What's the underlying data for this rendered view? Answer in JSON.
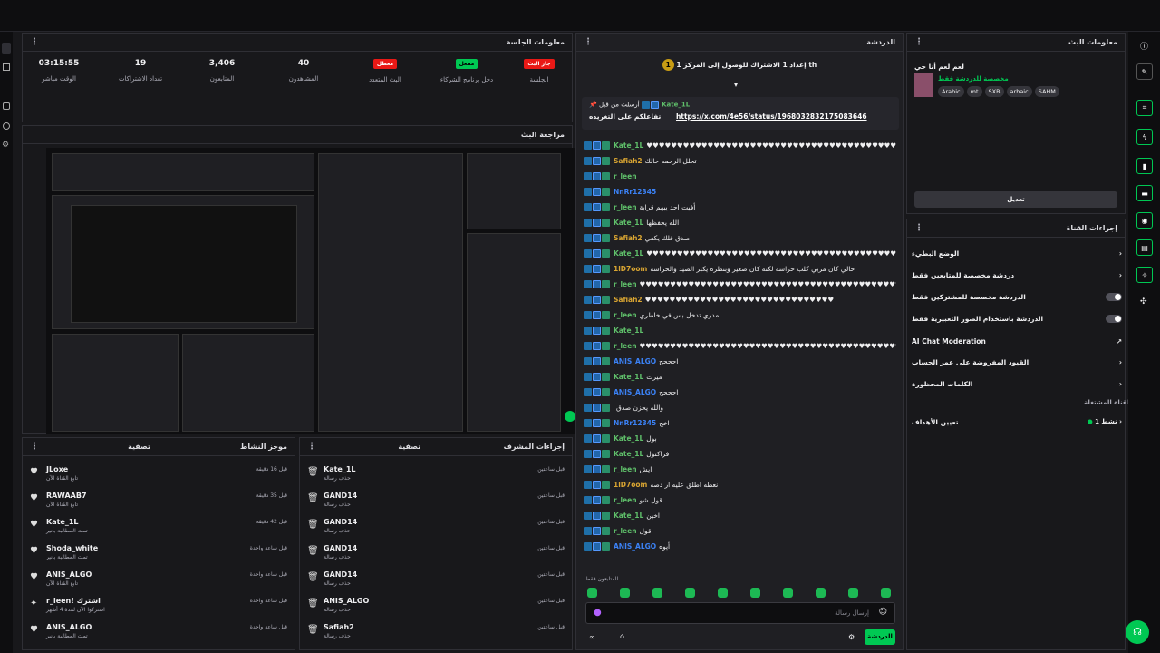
{
  "colors": {
    "accent": "#00c853",
    "red": "#e91916",
    "bg": "#18181b",
    "chat_bg": "#1f1f23"
  },
  "session_info": {
    "title": "معلومات الجلسة",
    "stats": [
      {
        "value": "03:15:55",
        "label": "الوقت مباشر"
      },
      {
        "value": "19",
        "label": "تعداد الاشتراكات"
      },
      {
        "value": "3,406",
        "label": "المتابعون"
      },
      {
        "value": "40",
        "label": "المشاهدون"
      },
      {
        "badge": "معطل",
        "label": "البث المتعدد"
      },
      {
        "badge": "مفعل",
        "label": "دخل برنامج الشركاء"
      },
      {
        "badge": "جار البث",
        "label": "الجلسة"
      }
    ]
  },
  "stream_preview": {
    "title": "مراجعة البث"
  },
  "activity_feed": {
    "title": "موجز النشاط",
    "filter": "تصفية",
    "items": [
      {
        "name": "JLoxe",
        "sub": "تابع القناة الآن",
        "time": "قبل 16 دقيقة",
        "icon": "heart-icon"
      },
      {
        "name": "RAWAAB7",
        "sub": "تابع القناة الآن",
        "time": "قبل 35 دقيقة",
        "icon": "heart-icon"
      },
      {
        "name": "Kate_1L",
        "sub": "تمت المطالبة بأنير",
        "time": "قبل 42 دقيقة",
        "icon": "heart-icon"
      },
      {
        "name": "Shoda_white",
        "sub": "تمت المطالبة بأنير",
        "time": "قبل ساعة واحدة",
        "icon": "heart-icon"
      },
      {
        "name": "ANIS_ALGO",
        "sub": "تابع القناة الآن",
        "time": "قبل ساعة واحدة",
        "icon": "heart-icon"
      },
      {
        "name": "r_leen! اشترك",
        "sub": "اشتركوا الآن لمدة 4 أشهر",
        "time": "قبل ساعة واحدة",
        "icon": "star-icon"
      },
      {
        "name": "ANIS_ALGO",
        "sub": "تمت المطالبة بأنير",
        "time": "قبل ساعة واحدة",
        "icon": "heart-icon"
      }
    ]
  },
  "mod_actions": {
    "title": "إجراءات المشرف",
    "filter": "تصفية",
    "items": [
      {
        "name": "Kate_1L",
        "sub": "حذف رسالة",
        "time": "قبل ساعتين"
      },
      {
        "name": "GAND14",
        "sub": "حذف رسالة",
        "time": "قبل ساعتين"
      },
      {
        "name": "GAND14",
        "sub": "حذف رسالة",
        "time": "قبل ساعتين"
      },
      {
        "name": "GAND14",
        "sub": "حذف رسالة",
        "time": "قبل ساعتين"
      },
      {
        "name": "GAND14",
        "sub": "حذف رسالة",
        "time": "قبل ساعتين"
      },
      {
        "name": "ANIS_ALGO",
        "sub": "حذف رسالة",
        "time": "قبل ساعتين"
      },
      {
        "name": "Safiah2",
        "sub": "حذف رسالة",
        "time": "قبل ساعتين"
      }
    ]
  },
  "chat": {
    "title": "الدردشة",
    "banner": "إعداد 1 الاشتراك للوصول إلى المركز 1 th",
    "pinned_user": "Kate_1L",
    "pinned_by": "أرسلت من قبل",
    "pinned_text": "تفاعلكم على التغريده",
    "pinned_link": "https://x.com/4e56/status/1968032832175083646",
    "followers_only": "المتابعون فقط",
    "input_placeholder": "إرسال رسالة",
    "send": "الدردشة",
    "messages": [
      {
        "user": "Kate_1L",
        "text": "♥♥♥♥♥♥♥♥♥♥♥♥♥♥♥♥♥♥♥♥♥♥♥♥♥♥♥♥♥♥♥♥♥♥♥♥♥♥♥♥♥♥♥♥♥♥♥♥♥♥♥♥♥♥♥♥♥♥♥♥*",
        "color": "#5fbf6a"
      },
      {
        "user": "Safiah2",
        "text": "تحلل الرحمه حالك",
        "color": "#d9a532"
      },
      {
        "user": "r_leen",
        "text": "",
        "color": "#5fbf6a"
      },
      {
        "user": "NnRr12345",
        "text": "",
        "color": "#3b82f6"
      },
      {
        "user": "r_leen",
        "text": "أفيت احد يبهم قرابة",
        "color": "#5fbf6a"
      },
      {
        "user": "Kate_1L",
        "text": "الله يحفظها",
        "color": "#5fbf6a"
      },
      {
        "user": "Safiah2",
        "text": "صدق فلك يكفي",
        "color": "#d9a532"
      },
      {
        "user": "Kate_1L",
        "text": "♥♥♥♥♥♥♥♥♥♥♥♥♥♥♥♥♥♥♥♥♥♥♥♥♥♥♥♥♥♥♥♥♥♥♥♥♥♥♥♥♥♥♥♥♥♥♥♥♥♥♥♥♥♥♥♥♥♥♥*",
        "color": "#5fbf6a"
      },
      {
        "user": "1lD7oom",
        "text": "خالي كان مربي كلب حراسه لكنه كان صغير وبنظره يكبر الصيد والحراسه",
        "color": "#d9a532"
      },
      {
        "user": "r_leen",
        "text": "♥♥♥♥♥♥♥♥♥♥♥♥♥♥♥♥♥♥♥♥♥♥♥♥♥♥♥♥♥♥♥♥♥♥♥♥♥♥♥♥♥♥♥",
        "color": "#5fbf6a"
      },
      {
        "user": "Safiah2",
        "text": "♥♥♥♥♥♥♥♥♥♥♥♥♥♥♥♥♥♥♥♥♥♥♥♥♥♥♥♥♥♥♥",
        "color": "#d9a532"
      },
      {
        "user": "r_leen",
        "text": "مدري تدخل بس في خاطري",
        "color": "#5fbf6a"
      },
      {
        "user": "Kate_1L",
        "text": "",
        "color": "#5fbf6a"
      },
      {
        "user": "r_leen",
        "text": "♥♥♥♥♥♥♥♥♥♥♥♥♥♥♥♥♥♥♥♥♥♥♥♥♥♥♥♥♥♥♥♥♥♥♥♥♥♥♥♥♥♥♥♥♥♥♥♥♥♥♥♥♥♥♥♥♥سجود",
        "color": "#5fbf6a"
      },
      {
        "user": "ANIS_ALGO",
        "text": "احححح",
        "color": "#3b82f6"
      },
      {
        "user": "Kate_1L",
        "text": "ميرت",
        "color": "#5fbf6a"
      },
      {
        "user": "ANIS_ALGO",
        "text": "احححح",
        "color": "#3b82f6"
      },
      {
        "user": "",
        "text": "والله يحزن صدق",
        "color": "#5fbf6a"
      },
      {
        "user": "NnRr12345",
        "text": "اخح",
        "color": "#3b82f6"
      },
      {
        "user": "Kate_1L",
        "text": "بول",
        "color": "#5fbf6a"
      },
      {
        "user": "Kate_1L",
        "text": "فراكتول",
        "color": "#5fbf6a"
      },
      {
        "user": "r_leen",
        "text": "ايش",
        "color": "#5fbf6a"
      },
      {
        "user": "1lD7oom",
        "text": "نعطه اطلق عليه ار دصه",
        "color": "#d9a532"
      },
      {
        "user": "r_leen",
        "text": "قول شو",
        "color": "#5fbf6a"
      },
      {
        "user": "Kate_1L",
        "text": "اخين",
        "color": "#5fbf6a"
      },
      {
        "user": "r_leen",
        "text": "قول",
        "color": "#5fbf6a"
      },
      {
        "user": "ANIS_ALGO",
        "text": "أيوه",
        "color": "#3b82f6"
      }
    ]
  },
  "stream_info": {
    "title": "معلومات البث",
    "stream_title": "لعم لعم أنا حي",
    "category": "مخصصة للدردشة فقط",
    "tags": [
      "Arabic",
      "mt",
      "SXB",
      "arbaic",
      "SAHM"
    ],
    "edit": "تعديل"
  },
  "channel_actions": {
    "title": "إجراءات القناة",
    "rows": [
      {
        "label": "الوضع البطيء",
        "type": "arrow"
      },
      {
        "label": "دردشة مخصصة للمتابعين فقط",
        "type": "arrow"
      },
      {
        "label": "الدردشة مخصصة للمشتركين فقط",
        "type": "toggle"
      },
      {
        "label": "الدردشة باستخدام الصور التعبيرية فقط",
        "type": "toggle"
      },
      {
        "label": "AI Chat Moderation",
        "type": "link"
      },
      {
        "label": "القيود المفروضة على عمر الحساب",
        "type": "arrow"
      },
      {
        "label": "الكلمات المحظورة",
        "type": "arrow"
      }
    ],
    "hosting": "القناة المشتغلة",
    "goal_label": "تعيين الأهداف",
    "goal_value": "نشط 1"
  }
}
